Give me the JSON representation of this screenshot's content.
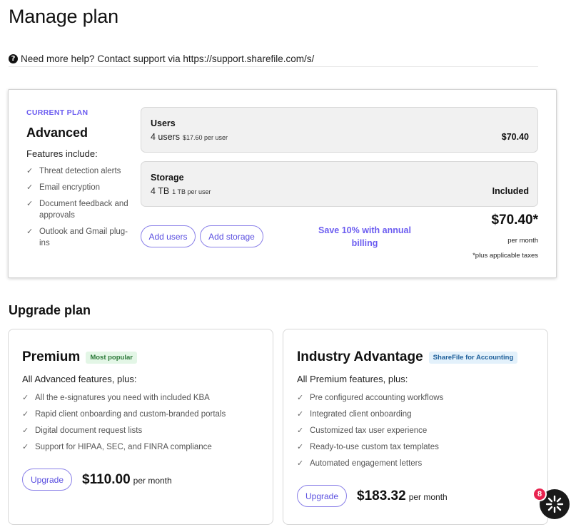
{
  "page": {
    "title": "Manage plan",
    "help_text": "Need more help? Contact support via https://support.sharefile.com/s/",
    "help_icon": "question-circle-icon"
  },
  "current_plan": {
    "label": "CURRENT PLAN",
    "name": "Advanced",
    "features_title": "Features include:",
    "features": [
      "Threat detection alerts",
      "Email encryption",
      "Document feedback and approvals",
      "Outlook and Gmail plug-ins"
    ],
    "users": {
      "title": "Users",
      "count": "4 users",
      "rate": "$17.60 per user",
      "price": "$70.40"
    },
    "storage": {
      "title": "Storage",
      "amount": "4 TB",
      "rate": "1 TB per user",
      "price": "Included"
    },
    "add_users_label": "Add users",
    "add_storage_label": "Add storage",
    "save_note": "Save 10% with annual billing",
    "total_price": "$70.40*",
    "total_per": "per month",
    "total_tax_note": "*plus applicable taxes"
  },
  "upgrade": {
    "section_title": "Upgrade plan",
    "plans": [
      {
        "name": "Premium",
        "badge": "Most popular",
        "subtitle": "All Advanced features, plus:",
        "features": [
          "All the e-signatures you need with included KBA",
          "Rapid client onboarding and custom-branded portals",
          "Digital document request lists",
          "Support for HIPAA, SEC, and FINRA compliance"
        ],
        "button_label": "Upgrade",
        "price": "$110.00",
        "per": "per month"
      },
      {
        "name": "Industry Advantage",
        "badge": "ShareFile for Accounting",
        "subtitle": "All Premium features, plus:",
        "features": [
          "Pre configured accounting workflows",
          "Integrated client onboarding",
          "Customized tax user experience",
          "Ready-to-use custom tax templates",
          "Automated engagement letters"
        ],
        "button_label": "Upgrade",
        "price": "$183.32",
        "per": "per month"
      }
    ]
  },
  "chat": {
    "badge_count": "8",
    "icon": "chat-assistant-icon"
  },
  "colors": {
    "accent": "#6b5cf0",
    "badge_green_bg": "#e3f6e6",
    "badge_blue_bg": "#e3f1fb",
    "notification": "#e8234f"
  }
}
